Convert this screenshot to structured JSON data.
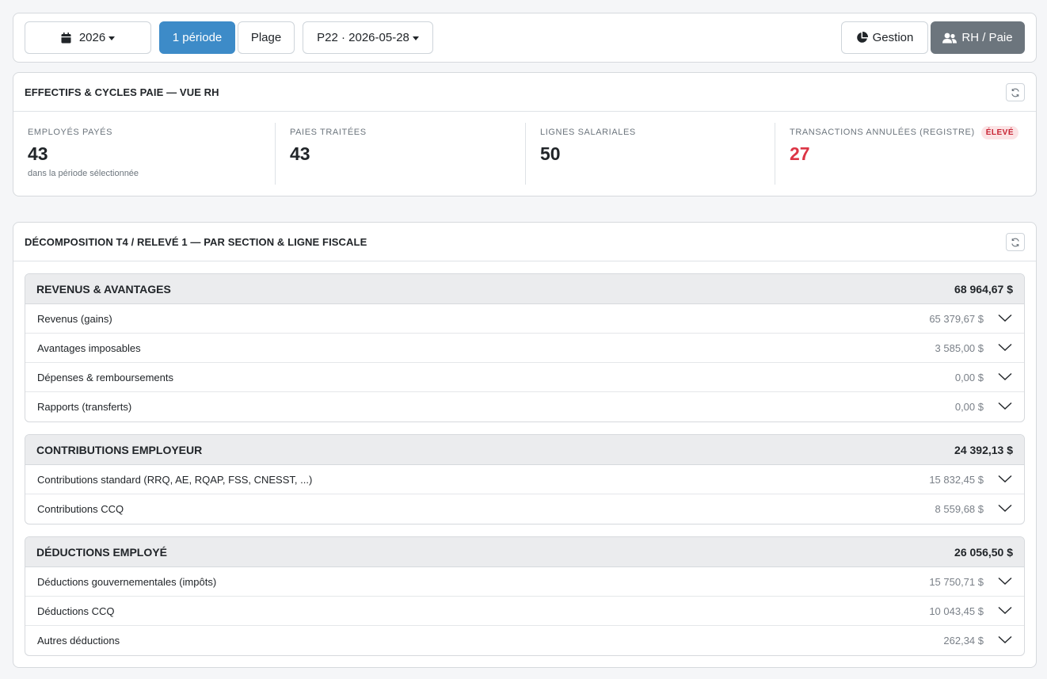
{
  "toolbar": {
    "year_label": "2026",
    "mode_single": "1 période",
    "mode_range": "Plage",
    "period_label": "P22 · 2026-05-28",
    "view_management": "Gestion",
    "view_hr": "RH / Paie"
  },
  "stats_card": {
    "title": "EFFECTIFS & CYCLES PAIE — VUE RH",
    "stats": [
      {
        "label": "EMPLOYÉS PAYÉS",
        "value": "43",
        "sub": "dans la période sélectionnée"
      },
      {
        "label": "PAIES TRAITÉES",
        "value": "43"
      },
      {
        "label": "LIGNES SALARIALES",
        "value": "50"
      },
      {
        "label": "TRANSACTIONS ANNULÉES (REGISTRE)",
        "value": "27",
        "badge": "ÉLEVÉ"
      }
    ]
  },
  "decomp_card": {
    "title": "DÉCOMPOSITION T4 / RELEVÉ 1 — PAR SECTION & LIGNE FISCALE",
    "sections": [
      {
        "title": "REVENUS & AVANTAGES",
        "total": "68 964,67 $",
        "rows": [
          {
            "label": "Revenus (gains)",
            "amount": "65 379,67 $"
          },
          {
            "label": "Avantages imposables",
            "amount": "3 585,00 $"
          },
          {
            "label": "Dépenses & remboursements",
            "amount": "0,00 $"
          },
          {
            "label": "Rapports (transferts)",
            "amount": "0,00 $"
          }
        ]
      },
      {
        "title": "CONTRIBUTIONS EMPLOYEUR",
        "total": "24 392,13 $",
        "rows": [
          {
            "label": "Contributions standard (RRQ, AE, RQAP, FSS, CNESST, ...)",
            "amount": "15 832,45 $"
          },
          {
            "label": "Contributions CCQ",
            "amount": "8 559,68 $"
          }
        ]
      },
      {
        "title": "DÉDUCTIONS EMPLOYÉ",
        "total": "26 056,50 $",
        "rows": [
          {
            "label": "Déductions gouvernementales (impôts)",
            "amount": "15 750,71 $"
          },
          {
            "label": "Déductions CCQ",
            "amount": "10 043,45 $"
          },
          {
            "label": "Autres déductions",
            "amount": "262,34 $"
          }
        ]
      }
    ]
  },
  "colors": {
    "primary": "#3d8bc8",
    "active_view": "#6c757d",
    "danger": "#dc3545"
  },
  "icons": {
    "year": "calendar-icon",
    "management": "pie-chart-icon",
    "hr": "users-icon",
    "refresh": "refresh-icon",
    "expand": "chevron-down-icon"
  }
}
